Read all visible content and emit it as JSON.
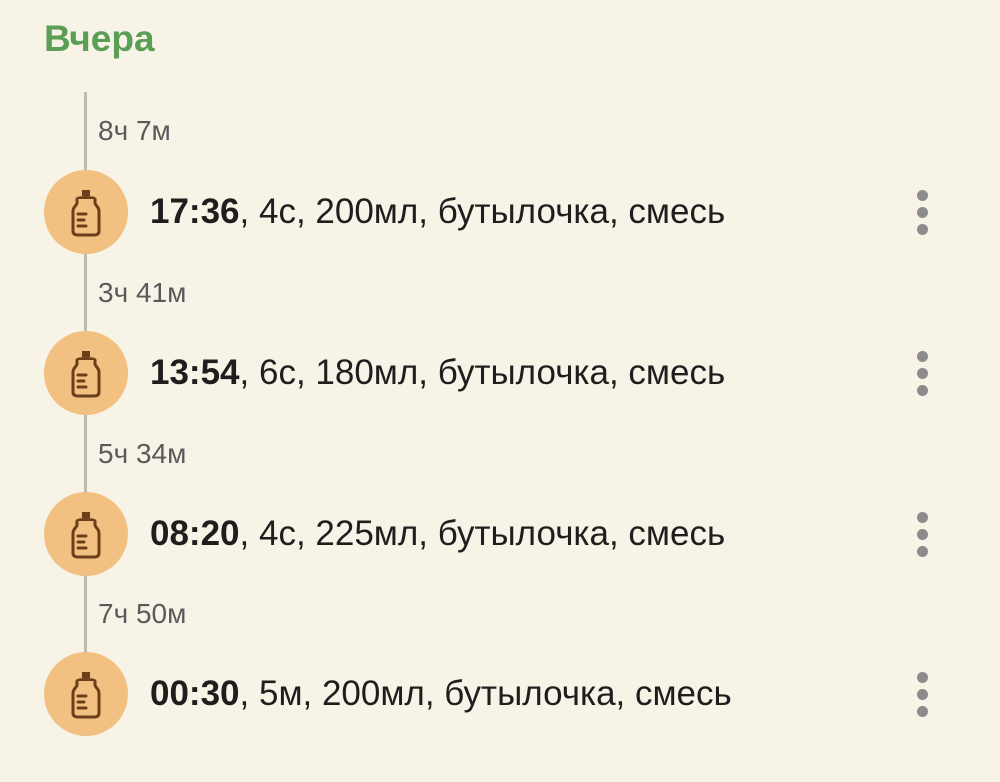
{
  "section": {
    "title": "Вчера"
  },
  "colors": {
    "background": "#f8f3e7",
    "section_title": "#5b9e55",
    "icon_circle": "#f2c080",
    "icon_stroke": "#6b3f1a",
    "timeline": "#bdbab1"
  },
  "gaps": [
    "8ч 7м",
    "3ч 41м",
    "5ч 34м",
    "7ч 50м"
  ],
  "entries": [
    {
      "time": "17:36",
      "details": ", 4с, 200мл, бутылочка, смесь",
      "icon": "baby-bottle-icon"
    },
    {
      "time": "13:54",
      "details": ", 6с, 180мл, бутылочка, смесь",
      "icon": "baby-bottle-icon"
    },
    {
      "time": "08:20",
      "details": ", 4с, 225мл, бутылочка, смесь",
      "icon": "baby-bottle-icon"
    },
    {
      "time": "00:30",
      "details": ", 5м, 200мл, бутылочка, смесь",
      "icon": "baby-bottle-icon"
    }
  ]
}
